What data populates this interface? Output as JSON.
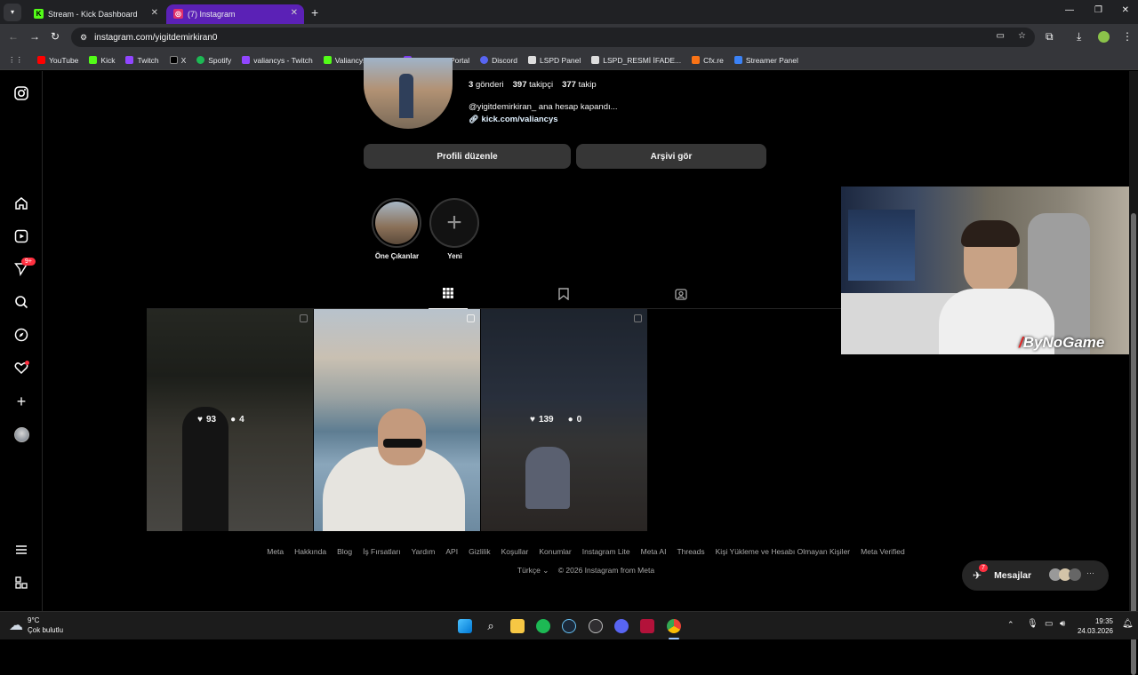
{
  "tabs": [
    {
      "label": "Stream - Kick Dashboard",
      "color": "#53fc18"
    },
    {
      "label": "(7) Instagram",
      "color": "#e1306c"
    }
  ],
  "address": "instagram.com/yigitdemirkiran0",
  "bookmarks": [
    "YouTube",
    "Kick",
    "Twitch",
    "X",
    "Spotify",
    "valiancys - Twitch",
    "Valiancys Stream",
    "Eightborn Portal",
    "Discord",
    "LSPD Panel",
    "LSPD_RESMİ İFADE...",
    "Cfx.re",
    "Streamer Panel"
  ],
  "sidebar": {
    "notification_badge": "9+"
  },
  "profile": {
    "posts": "3",
    "posts_label": "gönderi",
    "followers": "397",
    "followers_label": "takipçi",
    "following": "377",
    "following_label": "takip",
    "bio": "@yigitdemirkiran_ ana hesap kapandı...",
    "link": "kick.com/valiancys",
    "edit_button": "Profili düzenle",
    "archive_button": "Arşivi gör"
  },
  "highlights": [
    {
      "label": "Öne Çıkanlar"
    },
    {
      "label": "Yeni"
    }
  ],
  "posts": [
    {
      "likes": "93",
      "comments": "4"
    },
    {
      "likes": "",
      "comments": ""
    },
    {
      "likes": "139",
      "comments": "0"
    }
  ],
  "footer": {
    "links": [
      "Meta",
      "Hakkında",
      "Blog",
      "İş Fırsatları",
      "Yardım",
      "API",
      "Gizlilik",
      "Koşullar",
      "Konumlar",
      "Instagram Lite",
      "Meta AI",
      "Threads",
      "Kişi Yükleme ve Hesabı Olmayan Kişiler",
      "Meta Verified"
    ],
    "language": "Türkçe",
    "copyright": "© 2026 Instagram from Meta"
  },
  "messages": {
    "label": "Mesajlar",
    "badge": "7"
  },
  "overlay": {
    "watermark": "ByNoGame"
  },
  "taskbar": {
    "temp": "9°C",
    "weather": "Çok bulutlu",
    "time": "19:35",
    "date": "24.03.2026"
  }
}
